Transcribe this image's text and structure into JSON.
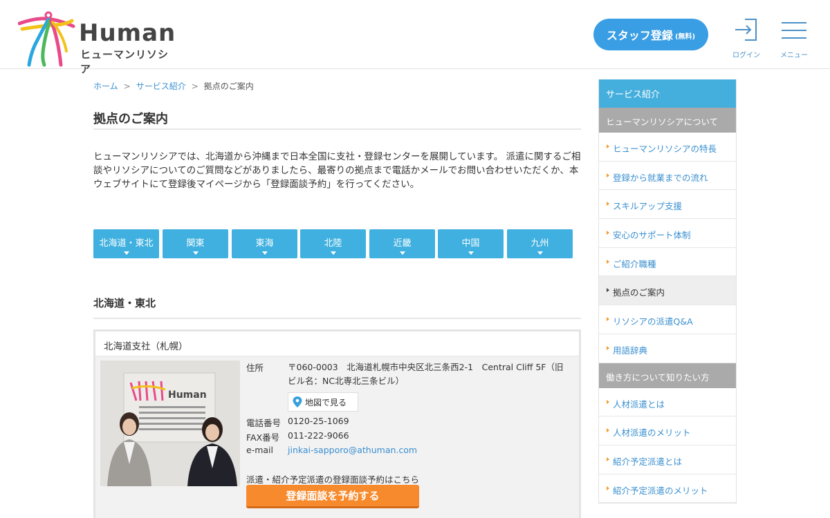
{
  "header": {
    "logo_text": "Human",
    "logo_sub": "ヒューマンリソシア",
    "staff_button": "スタッフ登録",
    "staff_button_note": "(無料)",
    "login_label": "ログイン",
    "menu_label": "メニュー"
  },
  "breadcrumb": {
    "home": "ホーム",
    "services": "サービス紹介",
    "current": "拠点のご案内",
    "separator": ">"
  },
  "page_title": "拠点のご案内",
  "intro": "ヒューマンリソシアでは、北海道から沖縄まで日本全国に支社・登録センターを展開しています。 派遣に関するご相談やリソシアについてのご質問などがありましたら、最寄りの拠点まで電話かメールでお問い合わせいただくか、本ウェブサイトにて登録後マイページから「登録面談予約」を行ってください。",
  "regions": [
    "北海道・東北",
    "関東",
    "東海",
    "北陸",
    "近畿",
    "中国",
    "九州"
  ],
  "section_title": "北海道・東北",
  "office": {
    "name": "北海道支社（札幌）",
    "address_label": "住所",
    "address": "〒060-0003　北海道札幌市中央区北三条西2-1　Central Cliff 5F（旧ビル名：NC北専北三条ビル）",
    "map_button": "地図で見る",
    "phone_label": "電話番号",
    "phone": "0120-25-1069",
    "fax_label": "FAX番号",
    "fax": "011-222-9066",
    "email_label": "e-mail",
    "email": "jinkai-sapporo@athuman.com",
    "reserve_note": "派遣・紹介予定派遣の登録面談予約はこちら",
    "reserve_button": "登録面談を予約する",
    "photo_sign_text": "Human"
  },
  "sidebar": {
    "heading": "サービス紹介",
    "cat1": "ヒューマンリソシアについて",
    "items1": [
      {
        "label": "ヒューマンリソシアの特長"
      },
      {
        "label": "登録から就業までの流れ"
      },
      {
        "label": "スキルアップ支援"
      },
      {
        "label": "安心のサポート体制"
      },
      {
        "label": "ご紹介職種"
      },
      {
        "label": "拠点のご案内"
      },
      {
        "label": "リソシアの派遣Q&A"
      },
      {
        "label": "用語辞典"
      }
    ],
    "cat2": "働き方について知りたい方",
    "items2": [
      {
        "label": "人材派遣とは"
      },
      {
        "label": "人材派遣のメリット"
      },
      {
        "label": "紹介予定派遣とは"
      },
      {
        "label": "紹介予定派遣のメリット"
      }
    ]
  },
  "colors": {
    "accent": "#3a9ee4",
    "tab": "#3fb0df",
    "reserve": "#f78a2c"
  }
}
